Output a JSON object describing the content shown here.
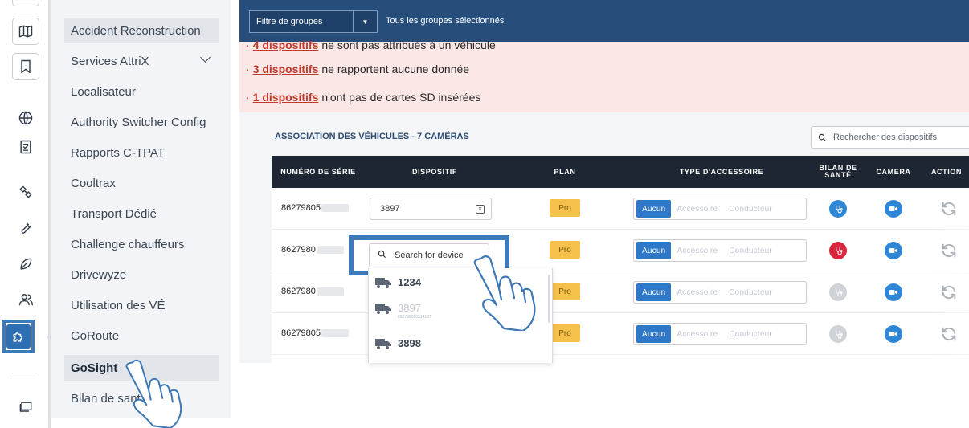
{
  "sidebar": {
    "rail_icons": [
      {
        "name": "map-icon"
      },
      {
        "name": "bookmark-icon"
      },
      {
        "name": "globe-icon"
      },
      {
        "name": "report-icon"
      },
      {
        "name": "satellite-icon"
      },
      {
        "name": "wrench-icon"
      },
      {
        "name": "leaf-icon"
      },
      {
        "name": "people-icon"
      },
      {
        "name": "puzzle-icon",
        "active": true
      },
      {
        "name": "chat-icon"
      }
    ],
    "items": [
      {
        "label": "Accident Reconstruction",
        "selected": true
      },
      {
        "label": "Services AttriX",
        "has_chevron": true
      },
      {
        "label": "Localisateur"
      },
      {
        "label": "Authority Switcher Config"
      },
      {
        "label": "Rapports C-TPAT"
      },
      {
        "label": "Cooltrax"
      },
      {
        "label": "Transport Dédié"
      },
      {
        "label": "Challenge chauffeurs"
      },
      {
        "label": "Drivewyze"
      },
      {
        "label": "Utilisation des VÉ"
      },
      {
        "label": "GoRoute"
      },
      {
        "label": "GoSight",
        "selected": true,
        "bold": true
      },
      {
        "label": "Bilan de sant"
      }
    ]
  },
  "topbar": {
    "group_filter_label": "Filtre de groupes",
    "group_filter_summary": "Tous les groupes sélectionnés"
  },
  "alerts": [
    {
      "count_link": "4 dispositifs",
      "text": "ne sont pas attribués à un véhicule"
    },
    {
      "count_link": "3 dispositifs",
      "text": "ne rapportent aucune donnée"
    },
    {
      "count_link": "1 dispositifs",
      "text": "n'ont pas de cartes SD insérées"
    }
  ],
  "section": {
    "title": "ASSOCIATION DES VÉHICULES - 7 CAMÉRAS",
    "search_placeholder": "Rechercher des dispositifs"
  },
  "table": {
    "headers": {
      "serial": "NUMÉRO DE SÉRIE",
      "device": "DISPOSITIF",
      "plan": "PLAN",
      "accessory": "TYPE D'ACCESSOIRE",
      "health_l1": "BILAN DE",
      "health_l2": "SANTÉ",
      "camera": "CAMERA",
      "action": "ACTION"
    },
    "accessory_options": [
      "Aucun",
      "Accessoire",
      "Conducteur"
    ],
    "rows": [
      {
        "serial": "86279805",
        "device": "3897",
        "plan": "Pro",
        "accessory": "Aucun",
        "health_color": "#2e86d6"
      },
      {
        "serial": "8627980",
        "device": "",
        "plan": "Pro",
        "accessory": "Aucun",
        "health_color": "#d7263d"
      },
      {
        "serial": "8627980",
        "device": "",
        "plan": "Pro",
        "accessory": "Aucun",
        "health_color": "#cfd3d8"
      },
      {
        "serial": "86279805",
        "device": "",
        "plan": "Pro",
        "accessory": "Aucun",
        "health_color": "#cfd3d8"
      }
    ]
  },
  "device_search": {
    "placeholder": "Search for device",
    "options": [
      {
        "name": "1234",
        "dim": false
      },
      {
        "name": "3897",
        "sub": "862798050514187",
        "dim": true
      },
      {
        "name": "3898",
        "dim": false
      }
    ]
  },
  "colors": {
    "topbar": "#274d7a",
    "alert_bg": "#fbe7e6",
    "table_head": "#1e2633",
    "accent_blue": "#2e78c7",
    "plan_badge": "#f6c14a",
    "highlight_outline": "#3c7abb"
  }
}
